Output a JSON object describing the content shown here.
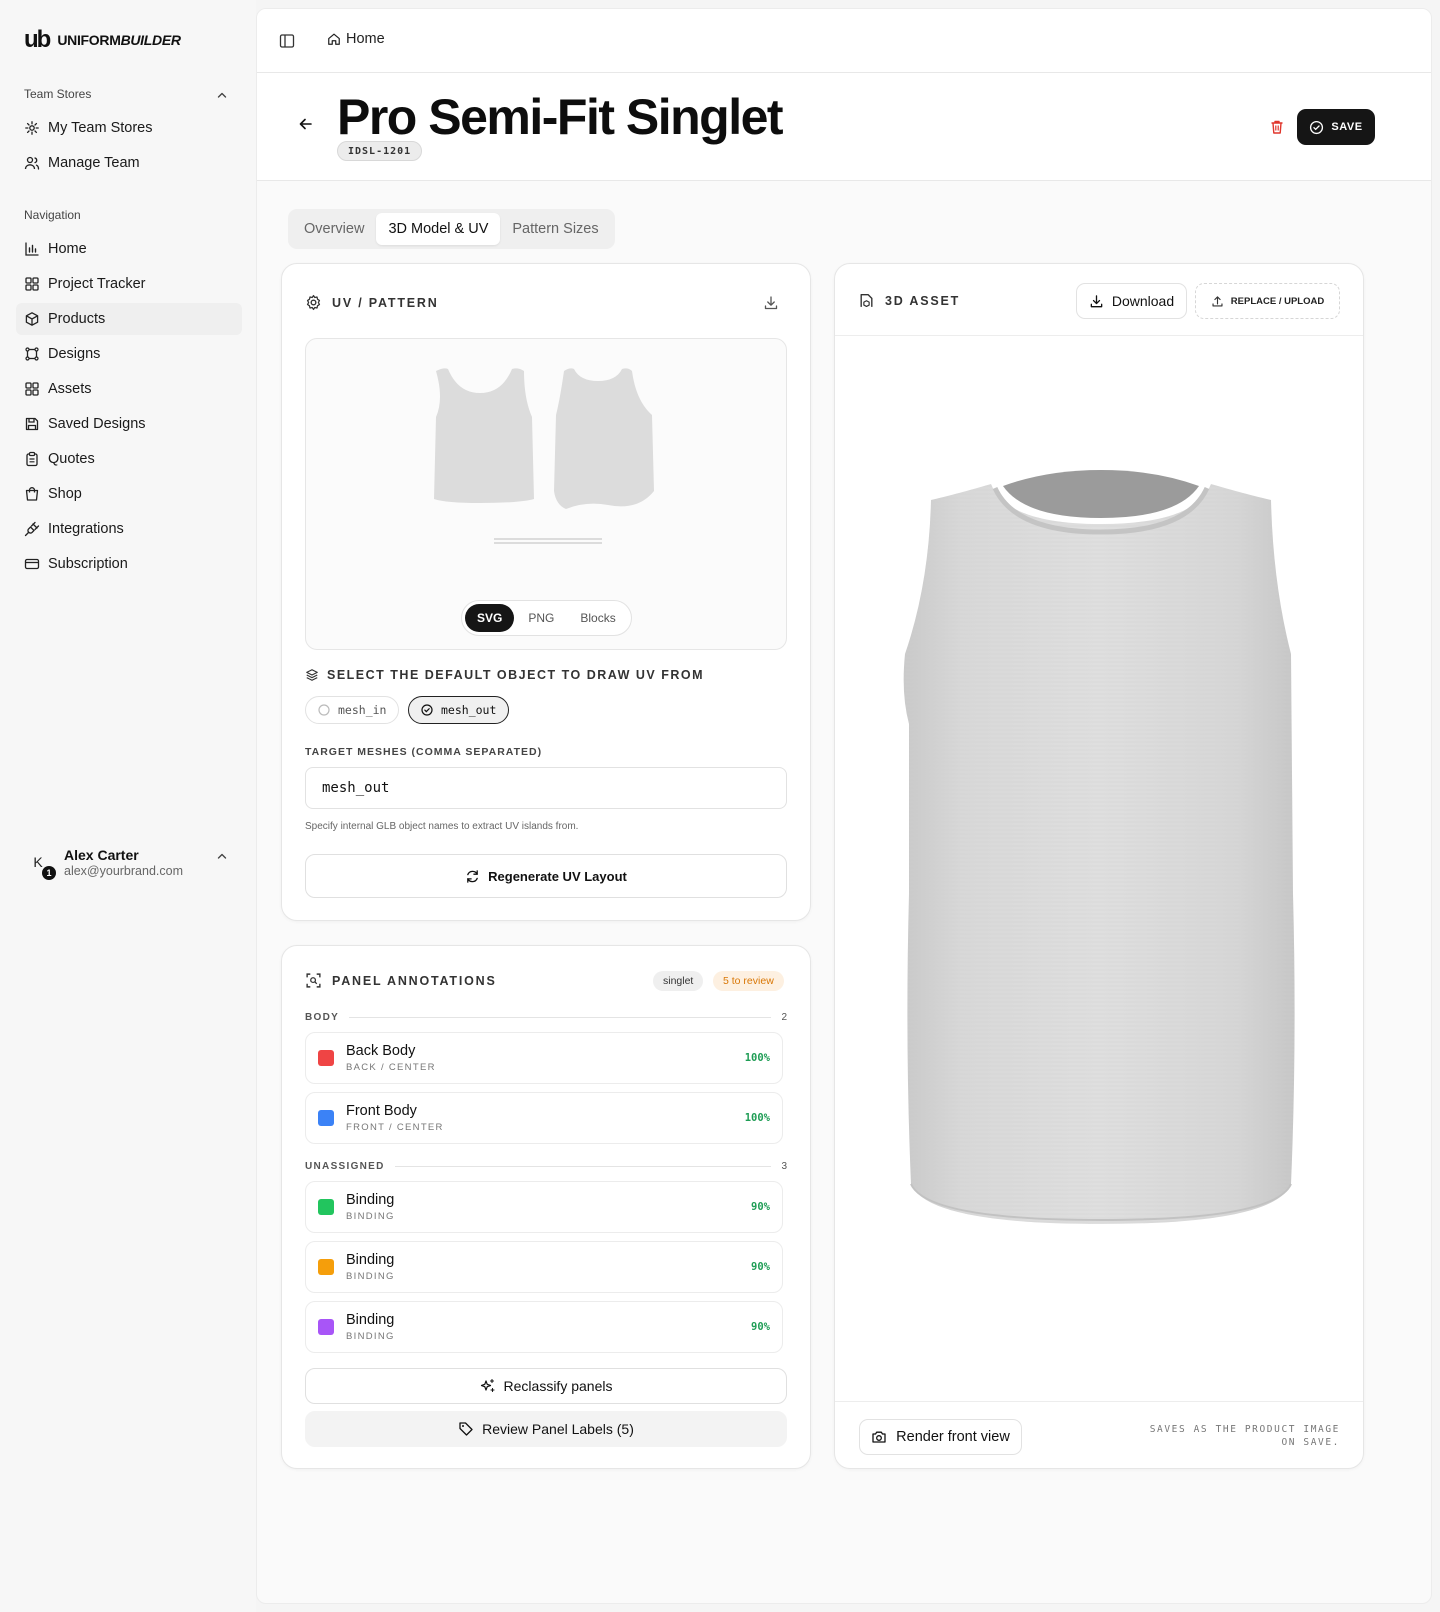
{
  "brand": {
    "mark": "ub",
    "name_regular": "UNIFORM",
    "name_italic": "BUILDER"
  },
  "sidebar": {
    "team_stores_label": "Team Stores",
    "team_items": [
      {
        "label": "My Team Stores",
        "icon": "gear-icon"
      },
      {
        "label": "Manage Team",
        "icon": "users-icon"
      }
    ],
    "navigation_label": "Navigation",
    "nav_items": [
      {
        "label": "Home",
        "icon": "bar-chart-icon"
      },
      {
        "label": "Project Tracker",
        "icon": "grid-icon"
      },
      {
        "label": "Products",
        "icon": "box-icon",
        "active": true
      },
      {
        "label": "Designs",
        "icon": "frame-icon"
      },
      {
        "label": "Assets",
        "icon": "grid-icon"
      },
      {
        "label": "Saved Designs",
        "icon": "save-icon"
      },
      {
        "label": "Quotes",
        "icon": "clipboard-icon"
      },
      {
        "label": "Shop",
        "icon": "bag-icon"
      },
      {
        "label": "Integrations",
        "icon": "plug-icon"
      },
      {
        "label": "Subscription",
        "icon": "card-icon"
      }
    ],
    "user": {
      "initial": "K",
      "badge": "1",
      "name": "Alex Carter",
      "email": "alex@yourbrand.com"
    }
  },
  "topbar": {
    "breadcrumb": "Home"
  },
  "header": {
    "title": "Pro Semi-Fit Singlet",
    "sku": "IDSL-1201",
    "save_label": "SAVE"
  },
  "tabs": [
    "Overview",
    "3D Model & UV",
    "Pattern Sizes"
  ],
  "uv": {
    "title": "UV / PATTERN",
    "formats": [
      "SVG",
      "PNG",
      "Blocks"
    ],
    "select_label": "SELECT THE DEFAULT OBJECT TO DRAW UV FROM",
    "meshes": [
      "mesh_in",
      "mesh_out"
    ],
    "target_label": "TARGET MESHES (COMMA SEPARATED)",
    "target_value": "mesh_out",
    "hint": "Specify internal GLB object names to extract UV islands from.",
    "regenerate_label": "Regenerate UV Layout"
  },
  "annotations": {
    "title": "PANEL ANNOTATIONS",
    "tag": "singlet",
    "review_badge": "5 to review",
    "groups": [
      {
        "name": "BODY",
        "count": "2",
        "items": [
          {
            "name": "Back Body",
            "sub": "BACK / CENTER",
            "pct": "100%",
            "color": "#ef4444"
          },
          {
            "name": "Front Body",
            "sub": "FRONT / CENTER",
            "pct": "100%",
            "color": "#3b82f6"
          }
        ]
      },
      {
        "name": "UNASSIGNED",
        "count": "3",
        "items": [
          {
            "name": "Binding",
            "sub": "BINDING",
            "pct": "90%",
            "color": "#22c55e"
          },
          {
            "name": "Binding",
            "sub": "BINDING",
            "pct": "90%",
            "color": "#f59e0b"
          },
          {
            "name": "Binding",
            "sub": "BINDING",
            "pct": "90%",
            "color": "#a855f7"
          }
        ]
      }
    ],
    "reclassify_label": "Reclassify panels",
    "review_label": "Review Panel Labels (5)"
  },
  "asset": {
    "title": "3D ASSET",
    "download_label": "Download",
    "upload_label": "REPLACE / UPLOAD",
    "render_label": "Render front view",
    "note": "SAVES AS THE PRODUCT IMAGE ON SAVE."
  }
}
